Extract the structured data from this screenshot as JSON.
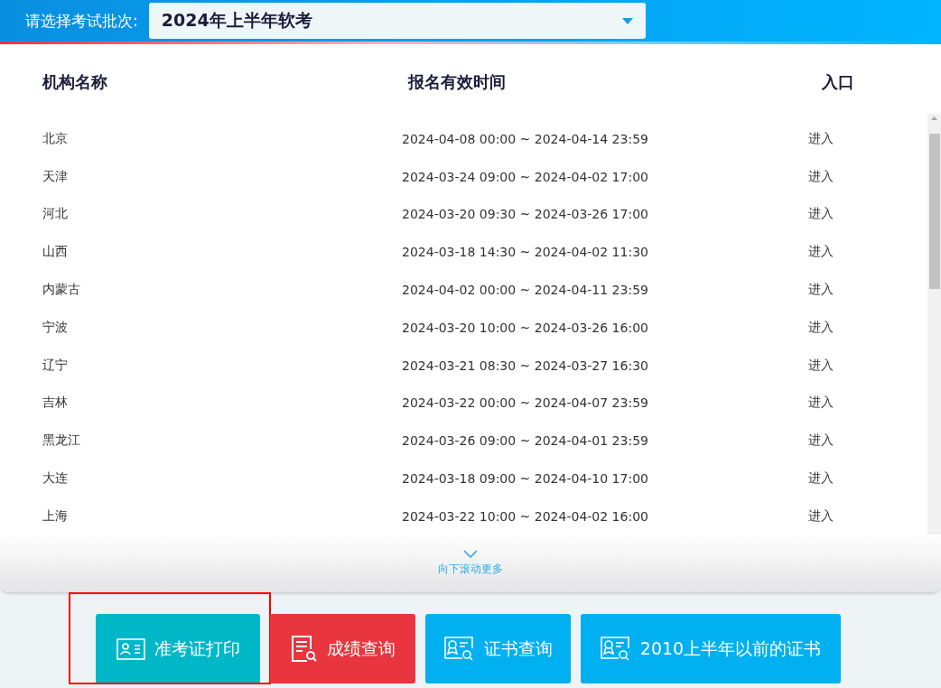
{
  "batch_selector": {
    "label": "请选择考试批次:",
    "value": "2024年上半年软考"
  },
  "table": {
    "columns": [
      "机构名称",
      "报名有效时间",
      "入口"
    ],
    "rows": [
      {
        "name": "北京",
        "period": "2024-04-08 00:00 ~ 2024-04-14 23:59",
        "entry": "进入"
      },
      {
        "name": "天津",
        "period": "2024-03-24 09:00 ~ 2024-04-02 17:00",
        "entry": "进入"
      },
      {
        "name": "河北",
        "period": "2024-03-20 09:30 ~ 2024-03-26 17:00",
        "entry": "进入"
      },
      {
        "name": "山西",
        "period": "2024-03-18 14:30 ~ 2024-04-02 11:30",
        "entry": "进入"
      },
      {
        "name": "内蒙古",
        "period": "2024-04-02 00:00 ~ 2024-04-11 23:59",
        "entry": "进入"
      },
      {
        "name": "宁波",
        "period": "2024-03-20 10:00 ~ 2024-03-26 16:00",
        "entry": "进入"
      },
      {
        "name": "辽宁",
        "period": "2024-03-21 08:30 ~ 2024-03-27 16:30",
        "entry": "进入"
      },
      {
        "name": "吉林",
        "period": "2024-03-22 00:00 ~ 2024-04-07 23:59",
        "entry": "进入"
      },
      {
        "name": "黑龙江",
        "period": "2024-03-26 09:00 ~ 2024-04-01 23:59",
        "entry": "进入"
      },
      {
        "name": "大连",
        "period": "2024-03-18 09:00 ~ 2024-04-10 17:00",
        "entry": "进入"
      },
      {
        "name": "上海",
        "period": "2024-03-22 10:00 ~ 2024-04-02 16:00",
        "entry": "进入"
      }
    ]
  },
  "scroll_hint": "向下滚动更多",
  "buttons": [
    {
      "label": "准考证打印",
      "kind": "ticket",
      "color": "#00b7c7",
      "highlighted": true
    },
    {
      "label": "成绩查询",
      "kind": "score",
      "color": "#e8353e",
      "highlighted": false
    },
    {
      "label": "证书查询",
      "kind": "cert",
      "color": "#00b0f0",
      "highlighted": false
    },
    {
      "label": "2010上半年以前的证书",
      "kind": "cert",
      "color": "#00b0f0",
      "highlighted": false
    }
  ]
}
